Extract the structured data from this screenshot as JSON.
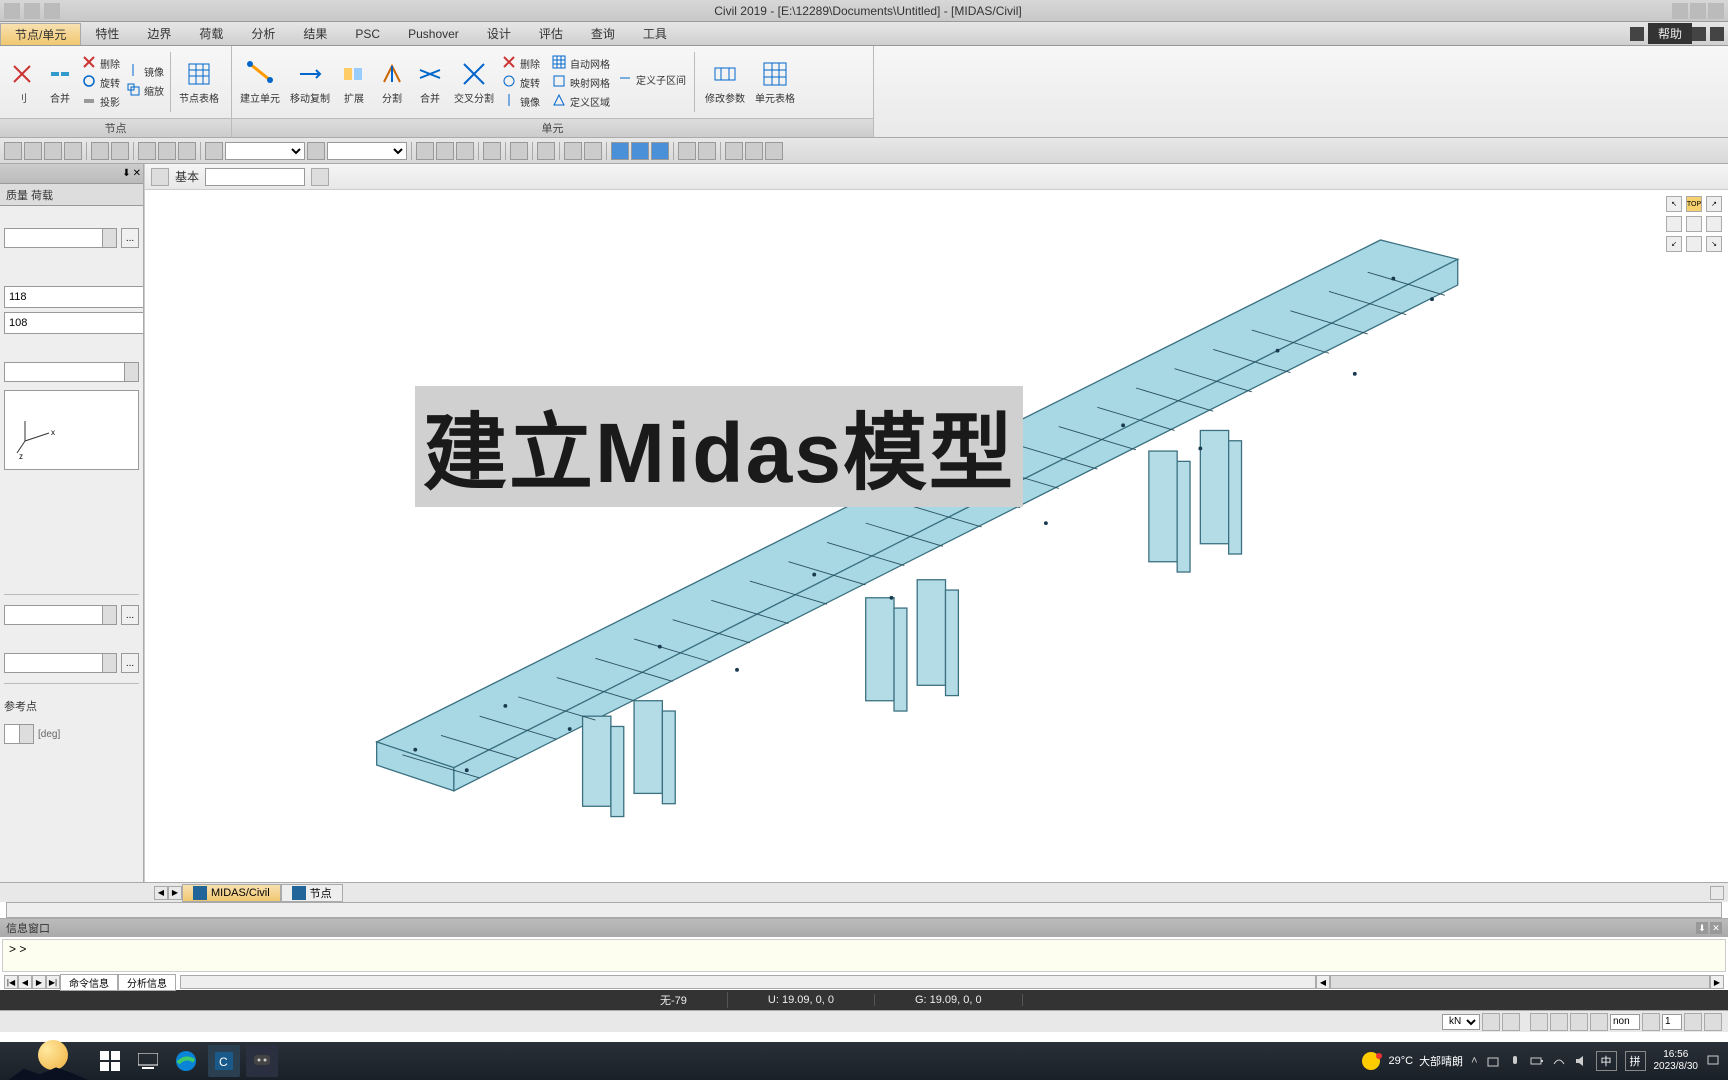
{
  "title": "Civil 2019 - [E:\\12289\\Documents\\Untitled] - [MIDAS/Civil]",
  "menu": {
    "tabs": [
      "节点/单元",
      "特性",
      "边界",
      "荷载",
      "分析",
      "结果",
      "PSC",
      "Pushover",
      "设计",
      "评估",
      "查询",
      "工具"
    ],
    "active": 0,
    "help": "帮助"
  },
  "ribbon": {
    "groups": [
      {
        "label": "节点",
        "big": [
          "刂",
          "合并"
        ],
        "small": [
          [
            "删除",
            "镜像"
          ],
          [
            "旋转",
            "缩放"
          ],
          [
            "投影",
            ""
          ]
        ],
        "tall": [
          "节点表格"
        ]
      },
      {
        "label": "单元",
        "big": [
          "建立单元",
          "移动复制",
          "扩展",
          "分割",
          "合并",
          "交叉分割"
        ],
        "small2": [
          [
            "删除"
          ],
          [
            "旋转"
          ],
          [
            "镜像"
          ]
        ],
        "small3": [
          [
            "自动网格",
            "定义子区间"
          ],
          [
            "映射网格",
            ""
          ],
          [
            "定义区域",
            ""
          ]
        ],
        "tall": [
          "修改参数",
          "单元表格"
        ]
      }
    ]
  },
  "left": {
    "tab": "质量  荷载",
    "input1": "118",
    "input2": "108",
    "footer_label": "参考点",
    "unit_hint": "[deg]"
  },
  "viewport": {
    "level": "基本"
  },
  "overlay": "建立Midas模型",
  "bottom": {
    "tabs": [
      "MIDAS/Civil",
      "节点"
    ]
  },
  "message": {
    "title": "信息窗口",
    "prompt": "> >",
    "tabs": [
      "命令信息",
      "分析信息"
    ]
  },
  "status": {
    "center": "无-79",
    "u": "U: 19.09, 0, 0",
    "g": "G: 19.09, 0, 0"
  },
  "status2": {
    "unit": "kN",
    "field1": "non",
    "field2": "1"
  },
  "taskbar": {
    "weather_temp": "29°C",
    "weather_txt": "大部晴朗",
    "ime1": "中",
    "ime2": "拼",
    "time": "16:56",
    "date": "2023/8/30"
  }
}
